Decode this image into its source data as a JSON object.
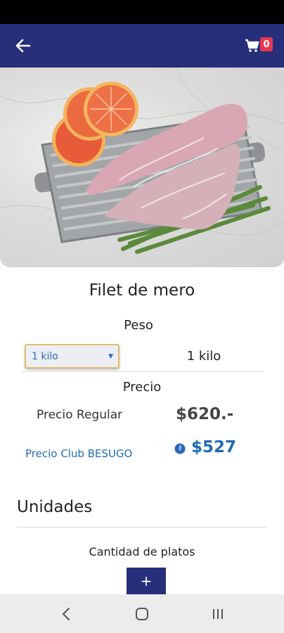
{
  "header": {
    "back_icon": "arrow-left-icon",
    "cart_icon": "shopping-cart-icon",
    "cart_count": "0",
    "background": "#272f7b"
  },
  "product": {
    "title": "Filet de mero",
    "image": "fish-fillet-photo"
  },
  "weight": {
    "label": "Peso",
    "selected_option": "1 kilo",
    "display_value": "1 kilo"
  },
  "price": {
    "label": "Precio",
    "regular_label": "Precio Regular",
    "regular_value": "$620.-",
    "club_label": "Precio Club BESUGO",
    "club_icon": "club-badge-icon",
    "club_value": "$527",
    "club_color": "#1f6cb4"
  },
  "units": {
    "section_title": "Unidades",
    "quantity_label": "Cantidad de platos",
    "add_button_label": "+"
  },
  "system_nav": {
    "back_icon": "nav-back-icon",
    "home_icon": "nav-home-icon",
    "recents_icon": "nav-recents-icon"
  }
}
